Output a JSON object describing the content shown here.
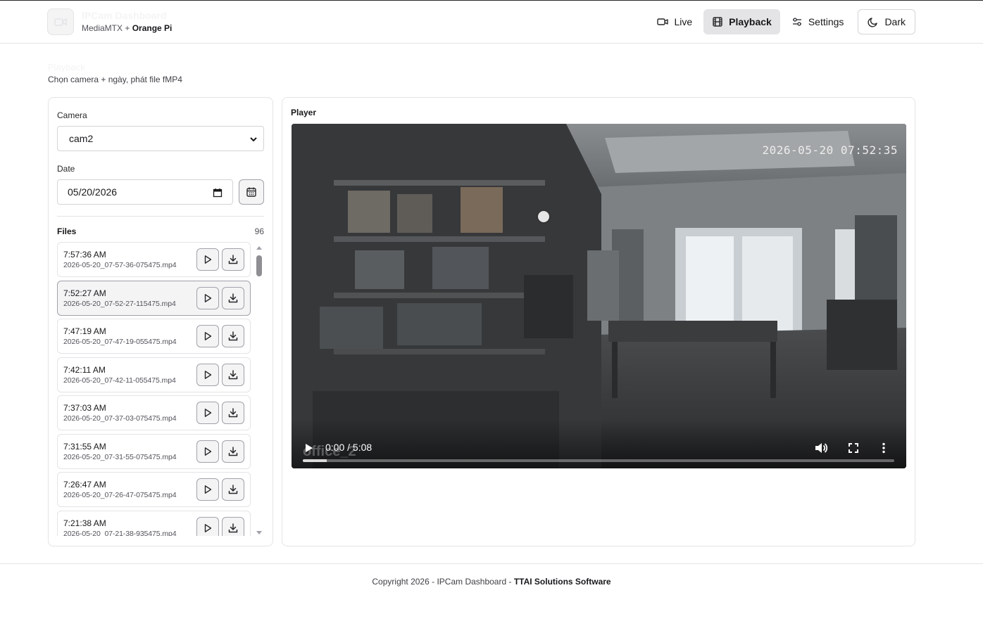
{
  "app": {
    "title": "IPCam Dashboard",
    "subtitle_prefix": "MediaMTX + ",
    "subtitle_strong": "Orange Pi"
  },
  "nav": {
    "live_label": "Live",
    "playback_label": "Playback",
    "settings_label": "Settings",
    "theme_label": "Dark",
    "active": "Playback"
  },
  "page": {
    "title": "Playback",
    "subtitle": "Chọn camera + ngày, phát file fMP4"
  },
  "filters": {
    "camera_label": "Camera",
    "camera_value": "cam2",
    "date_label": "Date",
    "date_value": "05/20/2026"
  },
  "files": {
    "label": "Files",
    "count": "96",
    "selected_index": 1,
    "items": [
      {
        "time": "7:57:36 AM",
        "name": "2026-05-20_07-57-36-075475.mp4"
      },
      {
        "time": "7:52:27 AM",
        "name": "2026-05-20_07-52-27-115475.mp4"
      },
      {
        "time": "7:47:19 AM",
        "name": "2026-05-20_07-47-19-055475.mp4"
      },
      {
        "time": "7:42:11 AM",
        "name": "2026-05-20_07-42-11-055475.mp4"
      },
      {
        "time": "7:37:03 AM",
        "name": "2026-05-20_07-37-03-075475.mp4"
      },
      {
        "time": "7:31:55 AM",
        "name": "2026-05-20_07-31-55-075475.mp4"
      },
      {
        "time": "7:26:47 AM",
        "name": "2026-05-20_07-26-47-075475.mp4"
      },
      {
        "time": "7:21:38 AM",
        "name": "2026-05-20_07-21-38-935475.mp4"
      }
    ]
  },
  "player": {
    "label": "Player",
    "timestamp_overlay": "2026-05-20 07:52:35",
    "camera_overlay": "office_2",
    "time_display": "0:00 / 5:08",
    "buffered_fraction": 0.04
  },
  "footer": {
    "prefix": "Copyright 2026 - IPCam Dashboard - ",
    "strong": "TTAI Solutions Software"
  },
  "colors": {
    "accent_bg": "#e4e4e7",
    "border": "#e4e4e7",
    "text": "#18181b"
  }
}
